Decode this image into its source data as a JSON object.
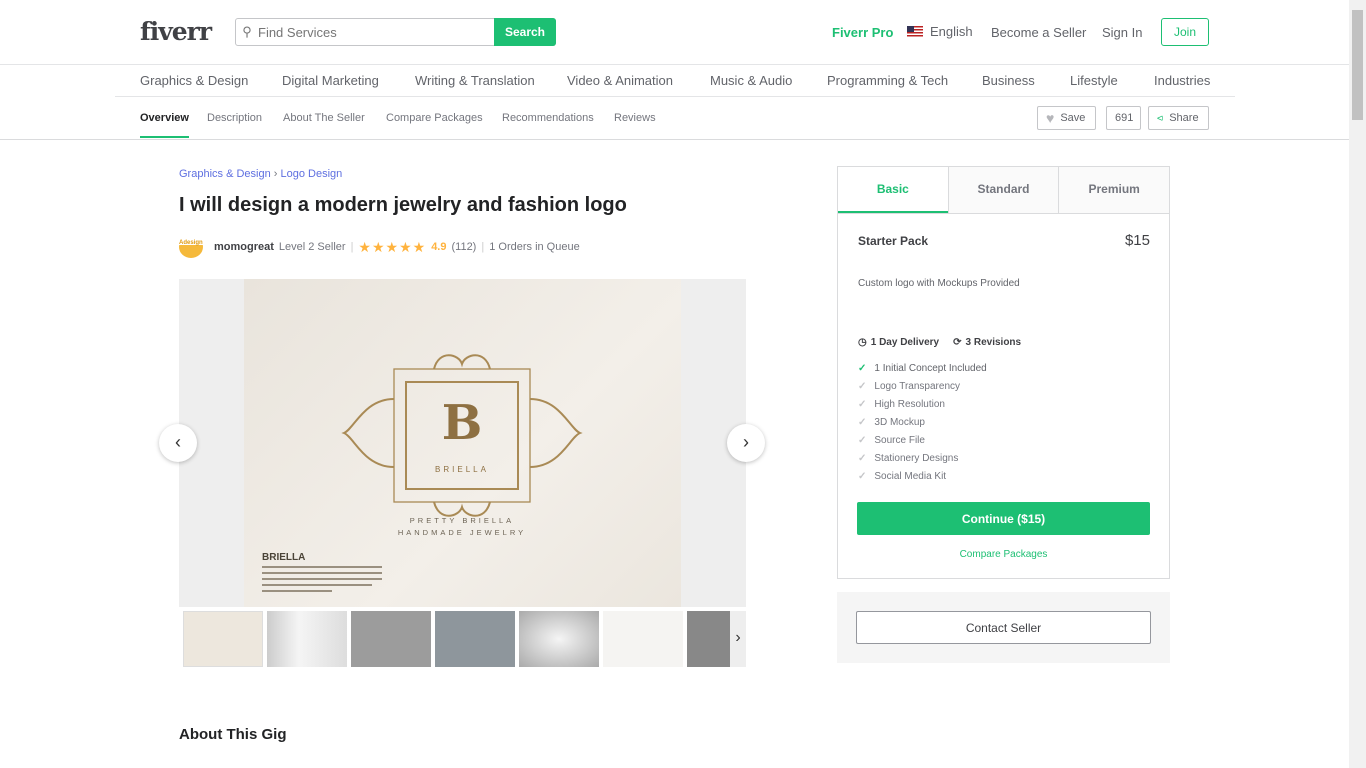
{
  "header": {
    "logo": "fiverr",
    "search_placeholder": "Find Services",
    "search_button": "Search",
    "fiverr_pro": "Fiverr Pro",
    "language": "English",
    "become_seller": "Become a Seller",
    "sign_in": "Sign In",
    "join": "Join"
  },
  "categories": [
    "Graphics & Design",
    "Digital Marketing",
    "Writing & Translation",
    "Video & Animation",
    "Music & Audio",
    "Programming & Tech",
    "Business",
    "Lifestyle",
    "Industries"
  ],
  "subnav": {
    "tabs": [
      "Overview",
      "Description",
      "About The Seller",
      "Compare Packages",
      "Recommendations",
      "Reviews"
    ],
    "save": "Save",
    "save_count": "691",
    "share": "Share"
  },
  "breadcrumb": [
    "Graphics & Design",
    "Logo Design"
  ],
  "title": "I will design a modern jewelry and fashion logo",
  "seller": {
    "name": "momogreat",
    "level": "Level 2 Seller",
    "rating": "4.9",
    "stars": 5,
    "reviews": "(112)",
    "queue": "1 Orders in Queue",
    "avatar_text": "Adesign"
  },
  "gallery": {
    "logo_letter": "B",
    "logo_name": "BRIELLA",
    "line1": "PRETTY BRIELLA",
    "line2": "HANDMADE JEWELRY",
    "brand": "BRIELLA",
    "thumb_count": 7
  },
  "package": {
    "tabs": [
      "Basic",
      "Standard",
      "Premium"
    ],
    "active": "Basic",
    "name": "Starter Pack",
    "price": "$15",
    "description": "Custom logo with Mockups Provided",
    "delivery": "1 Day Delivery",
    "revisions": "3 Revisions",
    "features": [
      {
        "label": "1 Initial Concept Included",
        "included": true
      },
      {
        "label": "Logo Transparency",
        "included": false
      },
      {
        "label": "High Resolution",
        "included": false
      },
      {
        "label": "3D Mockup",
        "included": false
      },
      {
        "label": "Source File",
        "included": false
      },
      {
        "label": "Stationery Designs",
        "included": false
      },
      {
        "label": "Social Media Kit",
        "included": false
      }
    ],
    "continue": "Continue ($15)",
    "compare": "Compare Packages"
  },
  "contact_seller": "Contact Seller",
  "about_heading": "About This Gig",
  "colors": {
    "brand": "#1dbf73",
    "star": "#ffb33e",
    "link": "#5e6fe0"
  }
}
